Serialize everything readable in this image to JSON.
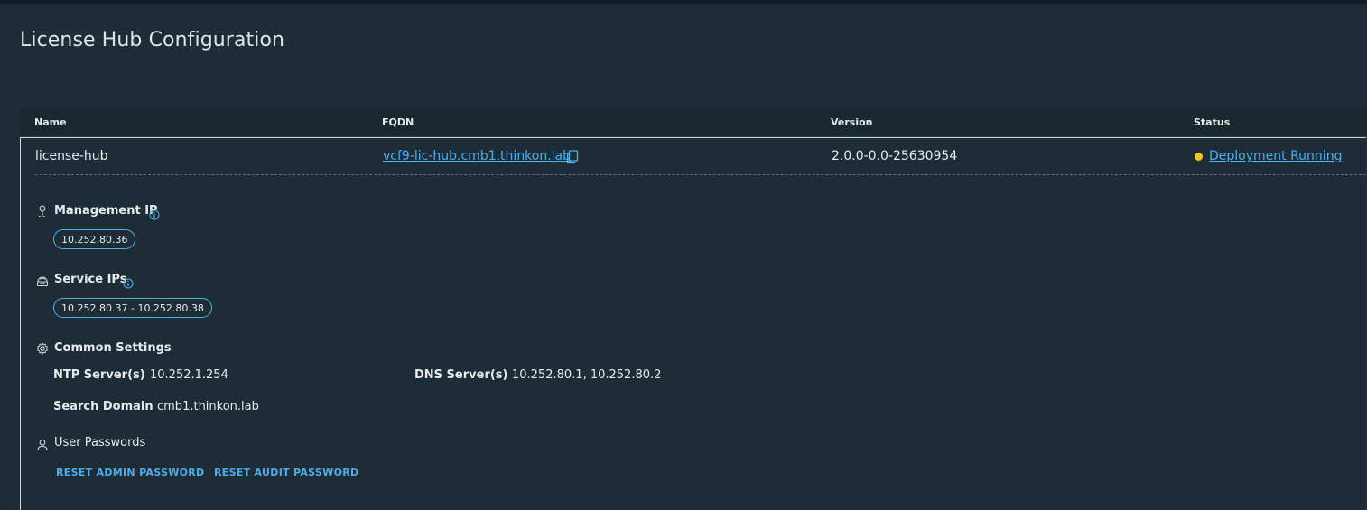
{
  "page": {
    "title": "License Hub Configuration"
  },
  "grid": {
    "columns": [
      "Name",
      "FQDN",
      "Version",
      "Status"
    ],
    "row": {
      "name": "license-hub",
      "fqdn": "vcf9-lic-hub.cmb1.thinkon.lab",
      "version": "2.0.0-0.0-25630954",
      "status": "Deployment Running",
      "status_color": "#f8c31b"
    }
  },
  "details": {
    "management_ip": {
      "title": "Management IP",
      "value": "10.252.80.36"
    },
    "service_ips": {
      "title": "Service IPs",
      "value": "10.252.80.37 - 10.252.80.38"
    },
    "common_settings": {
      "title": "Common Settings",
      "ntp_label": "NTP Server(s)",
      "ntp_value": "10.252.1.254",
      "dns_label": "DNS Server(s)",
      "dns_value": "10.252.80.1, 10.252.80.2",
      "search_domain_label": "Search Domain",
      "search_domain_value": "cmb1.thinkon.lab"
    },
    "user_passwords": {
      "title": "User Passwords",
      "reset_admin_label": "RESET ADMIN PASSWORD",
      "reset_audit_label": "RESET AUDIT PASSWORD"
    }
  },
  "colors": {
    "accent": "#49aff2",
    "background": "#1e2d35",
    "status_warning": "#f8c31b"
  },
  "icons": {
    "copy": "copy-icon",
    "management_ip": "pin-icon",
    "service_ips": "network-icon",
    "common_settings": "gear-icon",
    "user_passwords": "user-icon",
    "info": "info-icon"
  }
}
